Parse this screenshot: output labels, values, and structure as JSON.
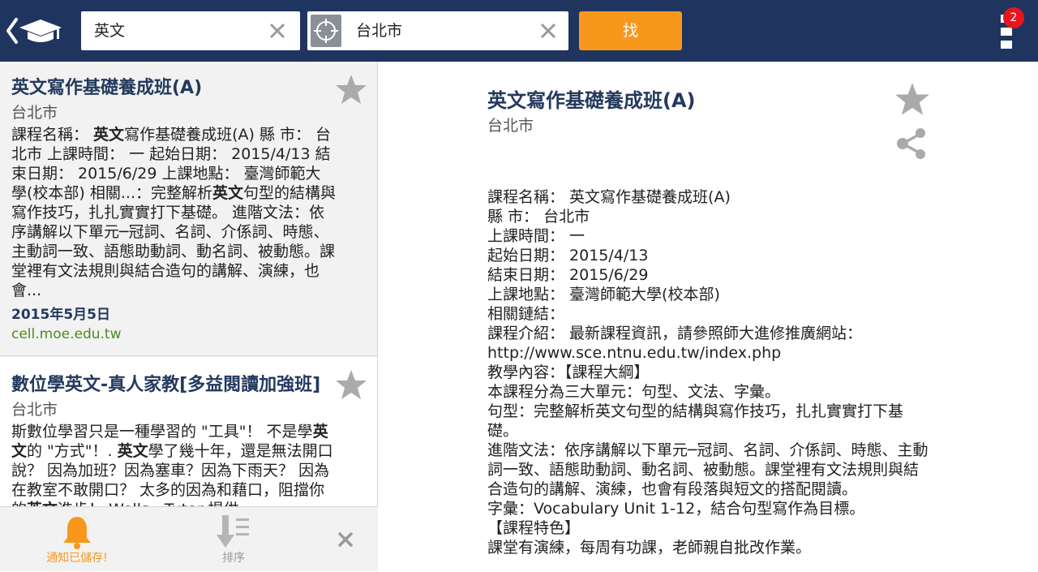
{
  "search": {
    "keyword": "英文",
    "location": "台北市",
    "find_label": "找"
  },
  "header": {
    "badge_count": "2"
  },
  "results": [
    {
      "title": "英文寫作基礎養成班(A)",
      "city": "台北市",
      "snippet_parts": [
        {
          "t": "課程名稱： "
        },
        {
          "t": "英文",
          "b": true
        },
        {
          "t": "寫作基礎養成班(A) 縣 市： 台北市 上課時間： 一 起始日期： 2015/4/13 結束日期： 2015/6/29 上課地點： 臺灣師範大學(校本部) 相關...：完整解析"
        },
        {
          "t": "英文",
          "b": true
        },
        {
          "t": "句型的結構與寫作技巧，扎扎實實打下基礎。 進階文法：依序講解以下單元─冠詞、名詞、介係詞、時態、主動詞一致、語態助動詞、動名詞、被動態。課堂裡有文法規則與結合造句的講解、演練，也會..."
        }
      ],
      "date": "2015年5月5日",
      "source": "cell.moe.edu.tw"
    },
    {
      "title": "數位學英文-真人家教[多益閱讀加強班]",
      "city": "台北市",
      "snippet_parts": [
        {
          "t": "斯數位學習只是一種學習的 \"工具\"！ 不是學"
        },
        {
          "t": "英文",
          "b": true
        },
        {
          "t": "的 \"方式\"！. "
        },
        {
          "t": "英文",
          "b": true
        },
        {
          "t": "學了幾十年，還是無法開口說？ 因為加班？因為塞車？因為下雨天？ 因為在教室不敢開口？ 太多的因為和藉口，阻擋你的"
        },
        {
          "t": "英文",
          "b": true
        },
        {
          "t": "進步！ Wells．Tutor 提供"
        }
      ]
    }
  ],
  "bottom": {
    "notify_label": "通知已儲存!",
    "sort_label": "排序"
  },
  "detail": {
    "title": "英文寫作基礎養成班(A)",
    "city": "台北市",
    "lines": [
      "課程名稱： 英文寫作基礎養成班(A)",
      "縣 市： 台北市",
      "上課時間： 一",
      "起始日期： 2015/4/13",
      "結束日期： 2015/6/29",
      "上課地點： 臺灣師範大學(校本部)",
      "相關鏈結：",
      "課程介紹： 最新課程資訊，請參照師大進修推廣網站：http://www.sce.ntnu.edu.tw/index.php",
      "教學內容：【課程大綱】",
      "本課程分為三大單元：句型、文法、字彙。",
      "句型：完整解析英文句型的結構與寫作技巧，扎扎實實打下基礎。",
      "進階文法：依序講解以下單元─冠詞、名詞、介係詞、時態、主動詞一致、語態助動詞、動名詞、被動態。課堂裡有文法規則與結合造句的講解、演練，也會有段落與短文的搭配閱讀。",
      "字彙：Vocabulary Unit 1-12，結合句型寫作為目標。",
      "【課程特色】",
      "課堂有演練，每周有功課，老師親自批改作業。"
    ]
  },
  "colors": {
    "header_bg": "#1f3560",
    "accent": "#f7981d",
    "title": "#23395e",
    "source": "#4e8b1f",
    "badge": "#e8141e"
  }
}
